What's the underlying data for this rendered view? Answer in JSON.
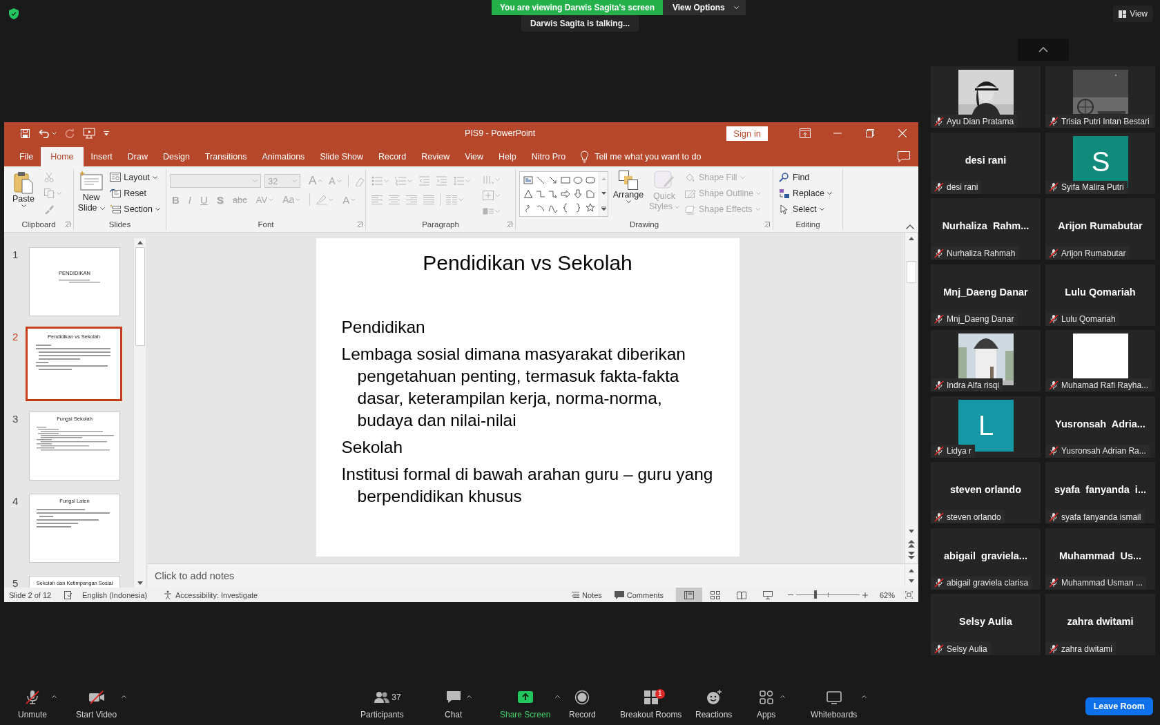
{
  "screen_share": {
    "banner": "You are viewing Darwis Sagita's screen",
    "view_options": "View Options",
    "talking": "Darwis Sagita is talking..."
  },
  "view_button": "View",
  "powerpoint": {
    "title": "PIS9  -  PowerPoint",
    "sign_in": "Sign in",
    "tabs": [
      {
        "label": "File",
        "selected": false
      },
      {
        "label": "Home",
        "selected": true
      },
      {
        "label": "Insert",
        "selected": false
      },
      {
        "label": "Draw",
        "selected": false
      },
      {
        "label": "Design",
        "selected": false
      },
      {
        "label": "Transitions",
        "selected": false
      },
      {
        "label": "Animations",
        "selected": false
      },
      {
        "label": "Slide Show",
        "selected": false
      },
      {
        "label": "Record",
        "selected": false
      },
      {
        "label": "Review",
        "selected": false
      },
      {
        "label": "View",
        "selected": false
      },
      {
        "label": "Help",
        "selected": false
      },
      {
        "label": "Nitro Pro",
        "selected": false
      }
    ],
    "tell_me": "Tell me what you want to do",
    "ribbon": {
      "clipboard": {
        "label": "Clipboard",
        "paste": "Paste"
      },
      "slides": {
        "label": "Slides",
        "new_slide": "New Slide",
        "items": [
          {
            "label": "Layout",
            "menu": true
          },
          {
            "label": "Reset",
            "menu": false
          },
          {
            "label": "Section",
            "menu": true
          }
        ]
      },
      "font": {
        "label": "Font",
        "disabled": true,
        "size": "32",
        "grow": "A",
        "shrink": "A",
        "format": [
          {
            "label": "B",
            "kind": "bold"
          },
          {
            "label": "I",
            "kind": "italic"
          },
          {
            "label": "U",
            "kind": "underline"
          },
          {
            "label": "S",
            "kind": "shadow"
          },
          {
            "label": "abc",
            "kind": "strike"
          },
          {
            "label": "AV",
            "kind": "spacing"
          },
          {
            "label": "Aa",
            "kind": "case"
          }
        ],
        "font_color": "A"
      },
      "paragraph": {
        "label": "Paragraph",
        "disabled": true
      },
      "drawing": {
        "label": "Drawing",
        "arrange": {
          "label": "Arrange",
          "disabled": false
        },
        "quick_styles": {
          "label": "Quick Styles",
          "disabled": true
        },
        "items": [
          {
            "label": "Shape Fill",
            "disabled": true
          },
          {
            "label": "Shape Outline",
            "disabled": true
          },
          {
            "label": "Shape Effects",
            "disabled": true
          }
        ]
      },
      "editing": {
        "label": "Editing",
        "items": [
          {
            "label": "Find",
            "menu": false
          },
          {
            "label": "Replace",
            "menu": true
          },
          {
            "label": "Select",
            "menu": true
          }
        ]
      }
    },
    "thumbnails": [
      {
        "number": "1",
        "selected": false,
        "kind": "title",
        "title": "PENDIDIKAN"
      },
      {
        "number": "2",
        "selected": true,
        "kind": "content",
        "title": "Pendidikan vs Sekolah"
      },
      {
        "number": "3",
        "selected": false,
        "kind": "content",
        "title": "Fungsi Sekolah"
      },
      {
        "number": "4",
        "selected": false,
        "kind": "content",
        "title": "Fungsi Laten"
      },
      {
        "number": "5",
        "selected": false,
        "kind": "content",
        "title": "Sekolah dan Ketimpangan Sosial"
      }
    ],
    "slide": {
      "title": "Pendidikan vs Sekolah",
      "paragraphs": [
        "Pendidikan",
        "Lembaga sosial dimana masyarakat diberikan pengetahuan penting, termasuk fakta-fakta dasar, keterampilan kerja, norma-norma, budaya dan nilai-nilai",
        "Sekolah",
        "Institusi formal di bawah arahan guru – guru yang berpendidikan khusus"
      ]
    },
    "notes_placeholder": "Click to add notes",
    "status_bar": {
      "slide": "Slide 2 of 12",
      "language": "English (Indonesia)",
      "accessibility": "Accessibility: Investigate",
      "notes": "Notes",
      "comments": "Comments",
      "views": [
        {
          "selected": true
        },
        {
          "selected": false
        },
        {
          "selected": false
        },
        {
          "selected": false
        }
      ],
      "zoom_slider": {
        "level": 0.3
      },
      "zoom": "62%"
    }
  },
  "gallery": [
    {
      "name": "Ayu Dian Pratama",
      "muted": true
    },
    {
      "name": "Trisia Putri Intan Bestari",
      "muted": true
    },
    {
      "name": "desi rani",
      "kind": "name",
      "display": "desi rani",
      "muted": true
    },
    {
      "name": "Syifa Malira Putri",
      "kind": "avatar",
      "letter": "S",
      "color": "#0f8a7b",
      "muted": true
    },
    {
      "name": "Nurhaliza Rahmah",
      "kind": "name",
      "display": "Nurhaliza  Rahm...",
      "muted": true
    },
    {
      "name": "Arijon Rumabutar",
      "kind": "name",
      "display": "Arijon Rumabutar",
      "muted": true
    },
    {
      "name": "Mnj_Daeng Danar",
      "kind": "name",
      "display": "Mnj_Daeng Danar",
      "muted": true
    },
    {
      "name": "Lulu Qomariah",
      "kind": "name",
      "display": "Lulu Qomariah",
      "muted": true
    },
    {
      "name": "Indra Alfa risqi",
      "muted": true
    },
    {
      "name": "Muhamad Rafi Rayha...",
      "kind": "blank",
      "muted": true
    },
    {
      "name": "Lidya r",
      "kind": "avatar",
      "letter": "L",
      "color": "#1597a6",
      "muted": true
    },
    {
      "name": "Yusronsah Adrian Ra...",
      "kind": "name",
      "display": "Yusronsah  Adria...",
      "muted": true
    },
    {
      "name": "steven orlando",
      "kind": "name",
      "display": "steven orlando",
      "muted": true
    },
    {
      "name": "syafa fanyanda ismail",
      "kind": "name",
      "display": "syafa  fanyanda  i...",
      "muted": true
    },
    {
      "name": "abigail graviela clarisa",
      "kind": "name",
      "display": "abigail  graviela...",
      "muted": true
    },
    {
      "name": "Muhammad Usman ...",
      "kind": "name",
      "display": "Muhammad  Us...",
      "muted": true
    },
    {
      "name": "Selsy Aulia",
      "kind": "name",
      "display": "Selsy Aulia",
      "muted": true
    },
    {
      "name": "zahra dwitami",
      "kind": "name",
      "display": "zahra dwitami",
      "muted": true
    }
  ],
  "toolbar": {
    "items": [
      {
        "label": "Unmute",
        "kind": "mic",
        "menu": true
      },
      {
        "label": "Start Video",
        "kind": "video",
        "menu": true
      },
      {
        "label": "Participants",
        "kind": "participants",
        "count": "37",
        "menu": false
      },
      {
        "label": "Chat",
        "kind": "chat",
        "menu": true
      },
      {
        "label": "Share Screen",
        "kind": "share",
        "menu": true
      },
      {
        "label": "Record",
        "kind": "record",
        "menu": false
      },
      {
        "label": "Breakout Rooms",
        "kind": "breakout",
        "badge": "1",
        "menu": false
      },
      {
        "label": "Reactions",
        "kind": "reactions",
        "menu": false
      },
      {
        "label": "Apps",
        "kind": "apps",
        "menu": true
      },
      {
        "label": "Whiteboards",
        "kind": "whiteboard",
        "menu": true
      }
    ],
    "leave": "Leave Room"
  }
}
